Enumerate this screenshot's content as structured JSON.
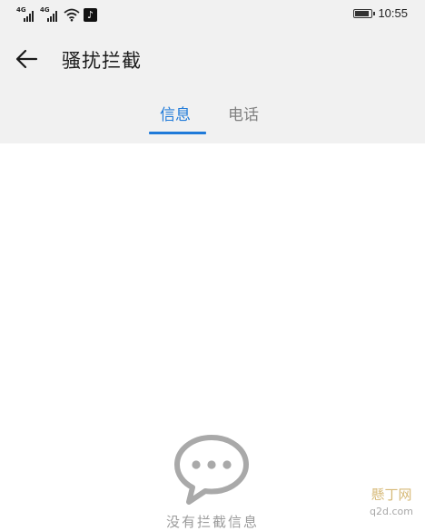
{
  "status_bar": {
    "signal_1_label": "4G",
    "signal_2_label": "4G",
    "battery_level": 0.92,
    "time": "10:55"
  },
  "header": {
    "back_icon": "arrow-left-icon",
    "title": "骚扰拦截"
  },
  "tabs": {
    "items": [
      {
        "label": "信息",
        "selected": true
      },
      {
        "label": "电话",
        "selected": false
      }
    ],
    "accent_color": "#1f7ad9"
  },
  "empty_state": {
    "icon": "chat-bubble-icon",
    "text": "没有拦截信息"
  },
  "watermark": {
    "line1": "懸丁网",
    "line2": "q2d.com"
  },
  "colors": {
    "header_bg": "#f1f1f1",
    "content_bg": "#ffffff",
    "icon_gray": "#a9a9a9"
  }
}
